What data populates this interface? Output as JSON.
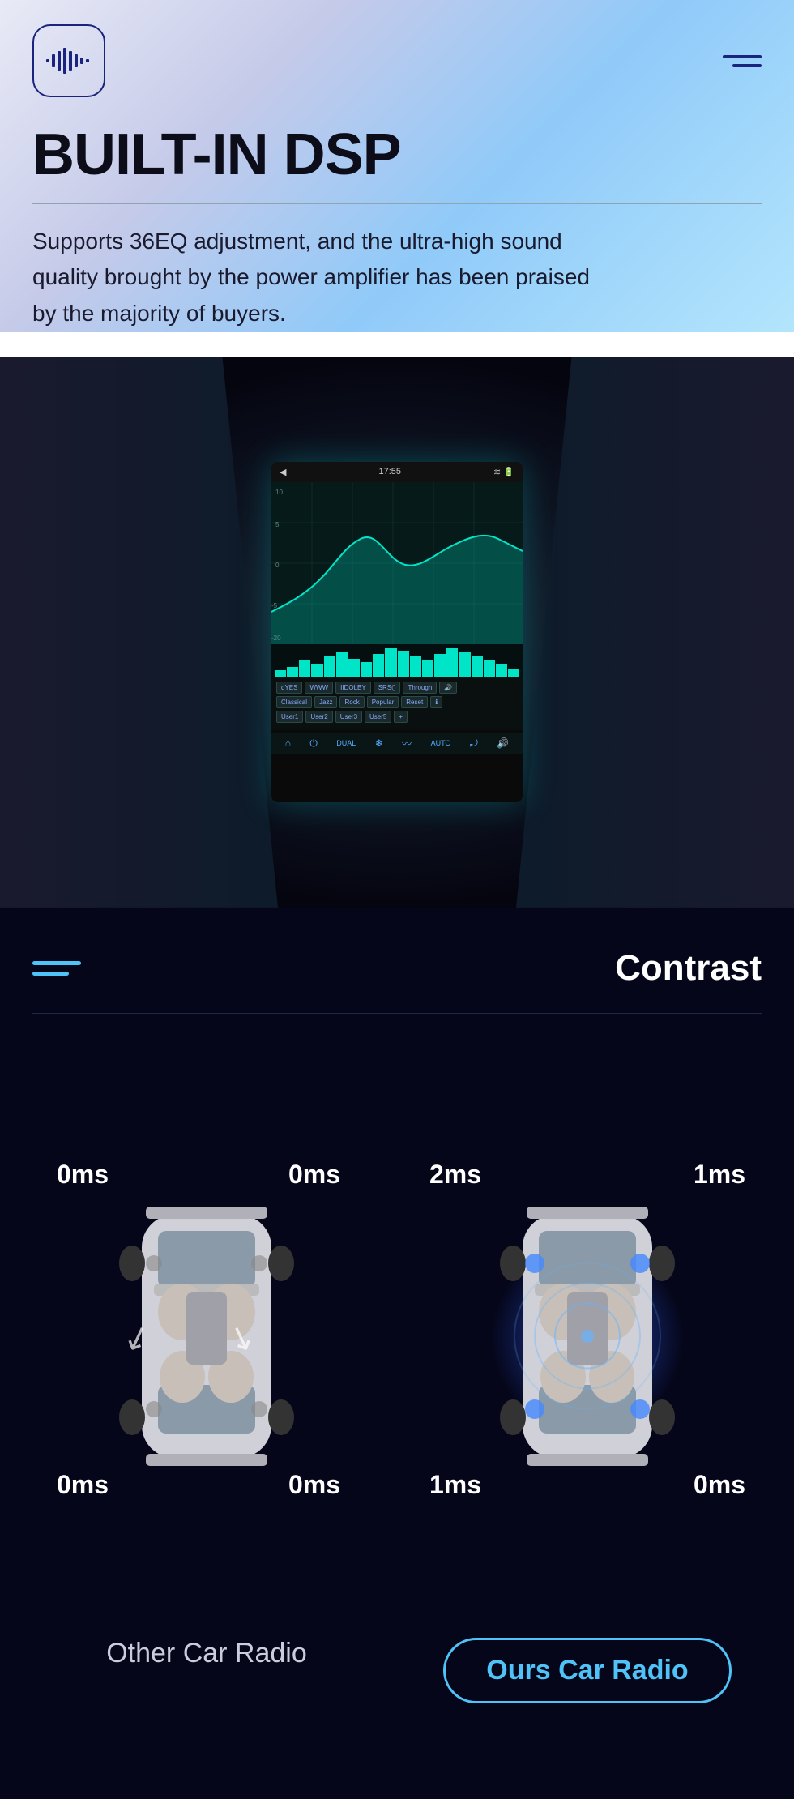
{
  "header": {
    "logo_alt": "audio-logo",
    "menu_alt": "hamburger-menu"
  },
  "hero": {
    "title": "BUILT-IN DSP",
    "subtitle": "Supports 36EQ adjustment, and the ultra-high sound quality brought by the power amplifier has been praised by the majority of buyers."
  },
  "dsp_screen": {
    "time": "17:55",
    "dual_label": "DUAL",
    "auto_label": "AUTO",
    "buttons": [
      "dYES",
      "WWW",
      "IIDDOLBY",
      "SRS()",
      "Through",
      "Classical",
      "Jazz",
      "Rock",
      "Popular",
      "Reset",
      "User1",
      "User2",
      "User3",
      "User5"
    ]
  },
  "contrast_section": {
    "title": "Contrast",
    "other_car": {
      "label": "Other Car Radio",
      "labels": {
        "top_left": "0ms",
        "top_right": "0ms",
        "bottom_left": "0ms",
        "bottom_right": "0ms"
      }
    },
    "our_car": {
      "label": "Ours Car Radio",
      "labels": {
        "top_left": "2ms",
        "top_right": "1ms",
        "bottom_left": "1ms",
        "bottom_right": "0ms"
      }
    }
  }
}
